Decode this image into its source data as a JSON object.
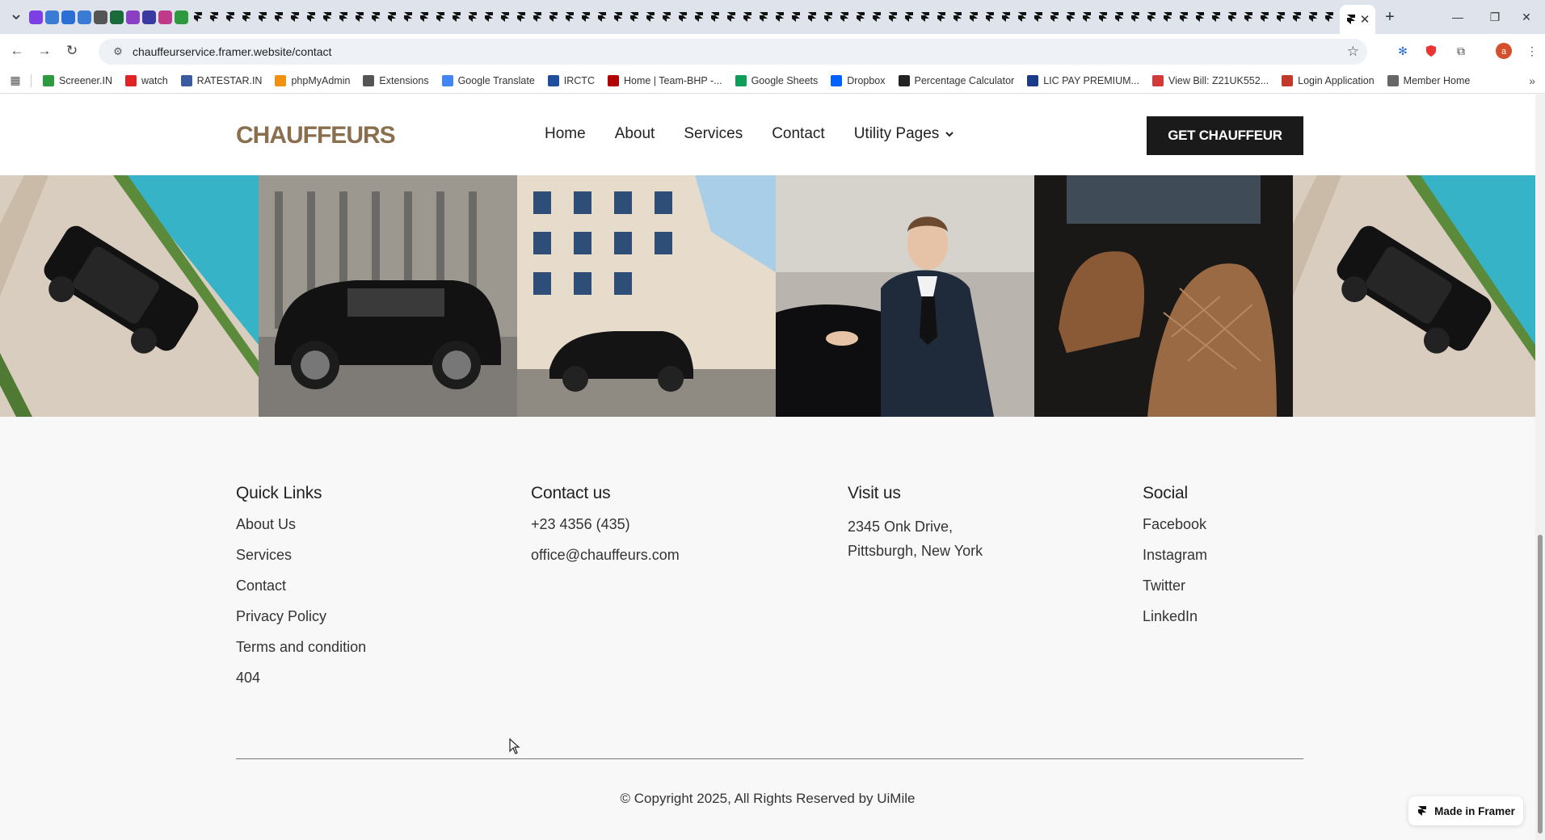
{
  "browser": {
    "url": "chauffeurservice.framer.website/contact",
    "bookmarks": [
      {
        "label": "Screener.IN",
        "color": "#2e9a3f"
      },
      {
        "label": "watch",
        "color": "#e02424"
      },
      {
        "label": "RATESTAR.IN",
        "color": "#3a5ba0"
      },
      {
        "label": "phpMyAdmin",
        "color": "#f29111"
      },
      {
        "label": "Extensions",
        "color": "#555555"
      },
      {
        "label": "Google Translate",
        "color": "#4285f4"
      },
      {
        "label": "IRCTC",
        "color": "#1f4e9c"
      },
      {
        "label": "Home | Team-BHP -...",
        "color": "#b00000"
      },
      {
        "label": "Google Sheets",
        "color": "#0f9d58"
      },
      {
        "label": "Dropbox",
        "color": "#0061fe"
      },
      {
        "label": "Percentage Calculator",
        "color": "#222222"
      },
      {
        "label": "LIC PAY PREMIUM...",
        "color": "#1a3a8a"
      },
      {
        "label": "View Bill: Z21UK552...",
        "color": "#d23a3a"
      },
      {
        "label": "Login Application",
        "color": "#c0392b"
      },
      {
        "label": "Member Home",
        "color": "#666666"
      }
    ]
  },
  "header": {
    "logo": "CHAUFFEURS",
    "nav": [
      "Home",
      "About",
      "Services",
      "Contact",
      "Utility Pages"
    ],
    "cta": "GET CHAUFFEUR"
  },
  "footer": {
    "quick_links": {
      "title": "Quick Links",
      "items": [
        "About Us",
        "Services",
        "Contact",
        "Privacy Policy",
        "Terms and condition",
        "404"
      ]
    },
    "contact": {
      "title": "Contact us",
      "phone": "+23 4356 (435)",
      "email": "office@chauffeurs.com"
    },
    "visit": {
      "title": "Visit us",
      "line1": "2345 Onk Drive,",
      "line2": "Pittsburgh, New York"
    },
    "social": {
      "title": "Social",
      "items": [
        "Facebook",
        "Instagram",
        "Twitter",
        "LinkedIn"
      ]
    },
    "copyright": "© Copyright 2025, All Rights Reserved by UiMile",
    "badge": "Made in Framer"
  },
  "colors": {
    "brand": "#8a6f4e",
    "cta_bg": "#1a1a1a",
    "page_bg": "#f8f8f8"
  }
}
